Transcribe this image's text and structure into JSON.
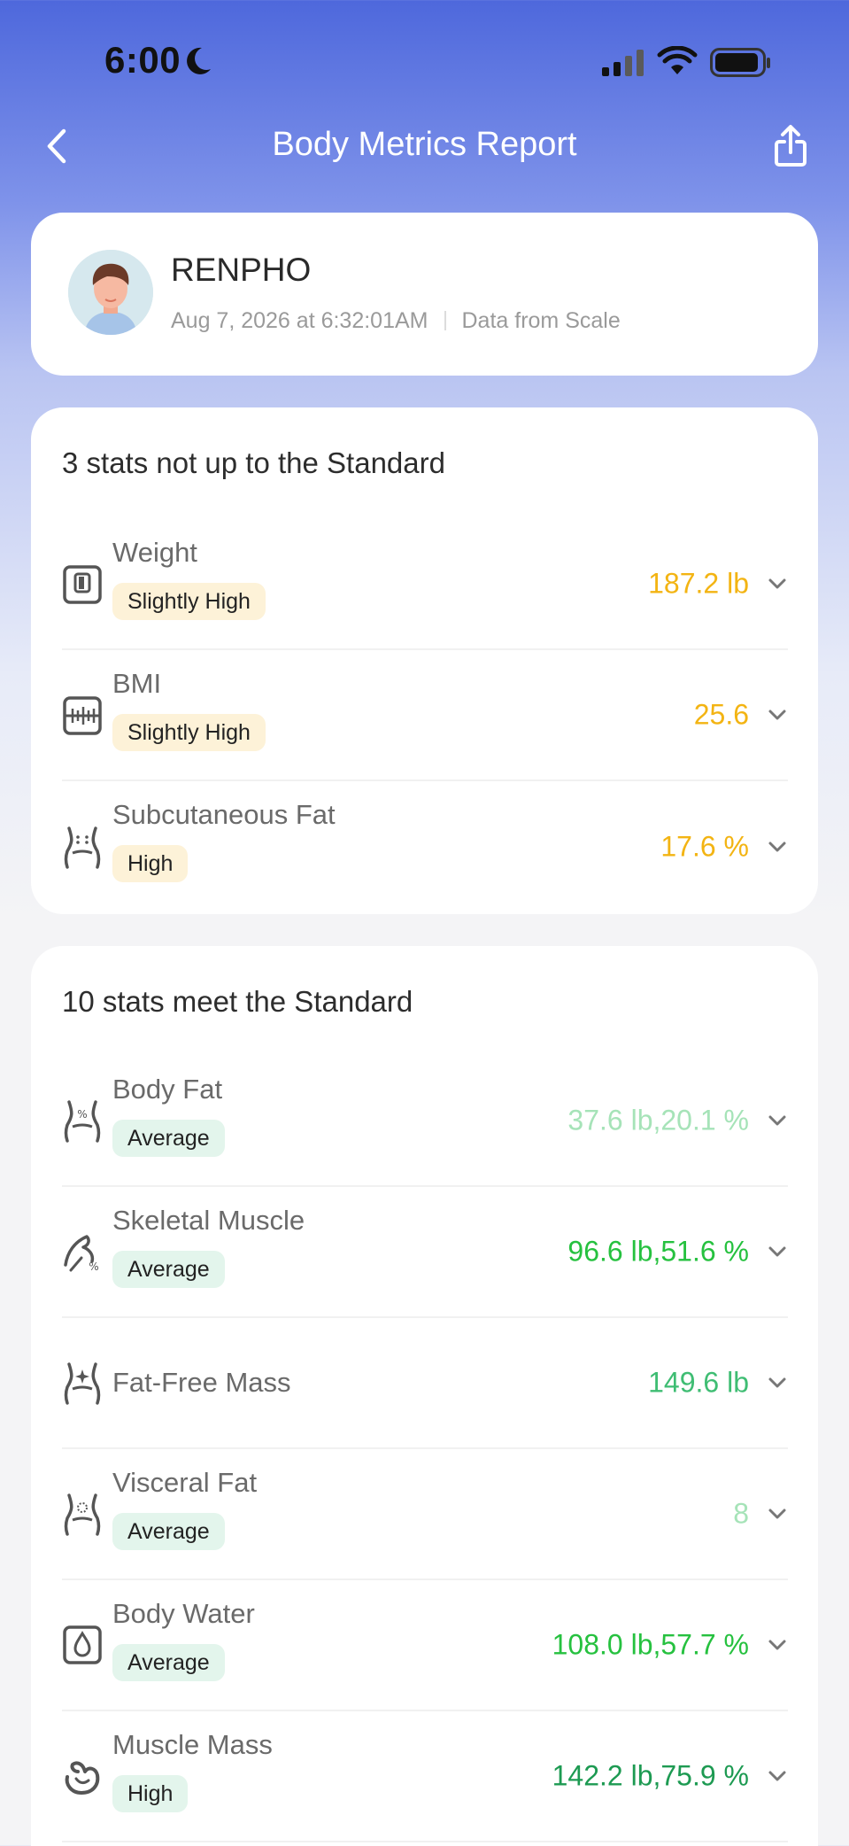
{
  "status_bar": {
    "time": "6:00"
  },
  "nav": {
    "title": "Body Metrics Report"
  },
  "profile": {
    "name": "RENPHO",
    "timestamp": "Aug 7, 2026 at 6:32:01AM",
    "source": "Data from Scale"
  },
  "section_below": {
    "title": "3 stats not up to the Standard",
    "items": [
      {
        "label": "Weight",
        "tag": "Slightly High",
        "value": "187.2 lb",
        "color": "#f3b413",
        "icon": "scale-icon"
      },
      {
        "label": "BMI",
        "tag": "Slightly High",
        "value": "25.6",
        "color": "#f3b413",
        "icon": "bmi-ruler-icon"
      },
      {
        "label": "Subcutaneous Fat",
        "tag": "High",
        "value": "17.6 %",
        "color": "#f3b413",
        "icon": "torso-dots-icon"
      }
    ]
  },
  "section_standard": {
    "title": "10 stats meet the Standard",
    "items": [
      {
        "label": "Body Fat",
        "tag": "Average",
        "value": "37.6 lb,20.1 %",
        "color": "#a6e3b8",
        "icon": "torso-percent-icon"
      },
      {
        "label": "Skeletal Muscle",
        "tag": "Average",
        "value": "96.6 lb,51.6 %",
        "color": "#26c13f",
        "icon": "muscle-arm-icon"
      },
      {
        "label": "Fat-Free Mass",
        "tag": "",
        "value": "149.6 lb",
        "color": "#3fbd73",
        "icon": "torso-sparkle-icon"
      },
      {
        "label": "Visceral Fat",
        "tag": "Average",
        "value": "8",
        "color": "#a6e3b8",
        "icon": "torso-circle-icon"
      },
      {
        "label": "Body Water",
        "tag": "Average",
        "value": "108.0 lb,57.7 %",
        "color": "#26c13f",
        "icon": "water-drop-icon"
      },
      {
        "label": "Muscle Mass",
        "tag": "High",
        "value": "142.2 lb,75.9 %",
        "color": "#1d9a52",
        "icon": "flexed-arm-icon"
      }
    ]
  }
}
